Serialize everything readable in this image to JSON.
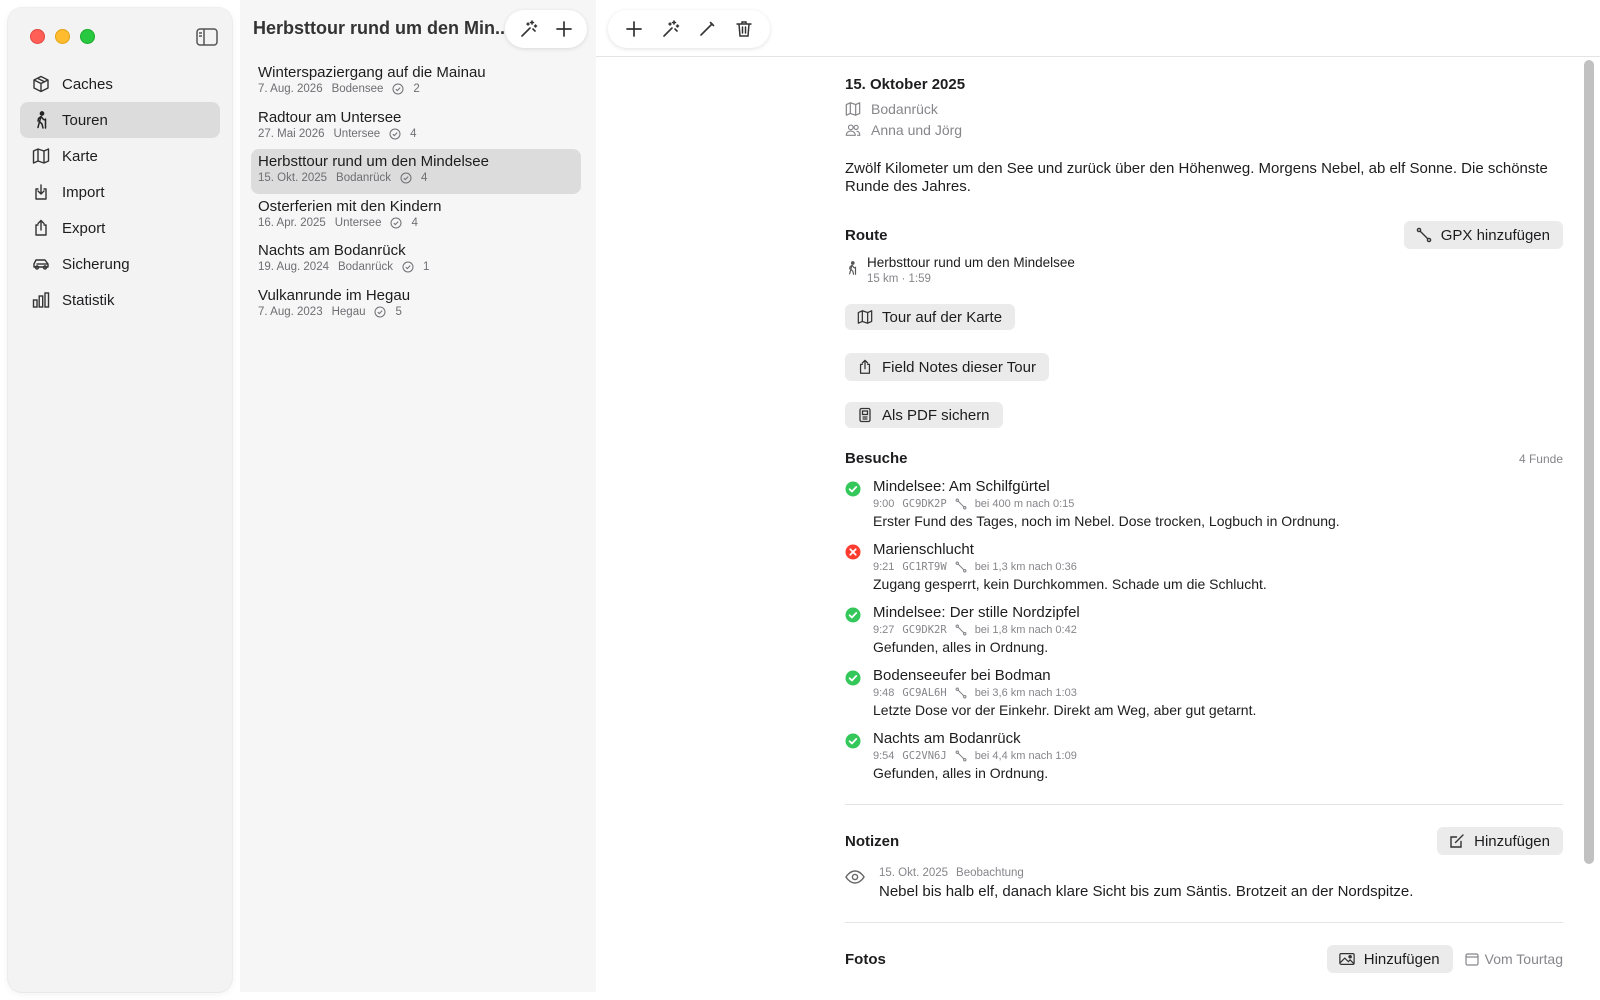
{
  "window": {
    "list_title": "Herbsttour rund um den Min..."
  },
  "sidebar": {
    "items": [
      {
        "label": "Caches",
        "icon": "cube-icon"
      },
      {
        "label": "Touren",
        "icon": "hiker-icon"
      },
      {
        "label": "Karte",
        "icon": "map-icon"
      },
      {
        "label": "Import",
        "icon": "import-icon"
      },
      {
        "label": "Export",
        "icon": "share-icon"
      },
      {
        "label": "Sicherung",
        "icon": "backup-car-icon"
      },
      {
        "label": "Statistik",
        "icon": "bar-chart-icon"
      }
    ],
    "active_index": 1
  },
  "tours": [
    {
      "name": "Winterspaziergang auf die Mainau",
      "date": "7. Aug. 2026",
      "region": "Bodensee",
      "count": "2"
    },
    {
      "name": "Radtour am Untersee",
      "date": "27. Mai 2026",
      "region": "Untersee",
      "count": "4"
    },
    {
      "name": "Herbsttour rund um den Mindelsee",
      "date": "15. Okt. 2025",
      "region": "Bodanrück",
      "count": "4"
    },
    {
      "name": "Osterferien mit den Kindern",
      "date": "16. Apr. 2025",
      "region": "Untersee",
      "count": "4"
    },
    {
      "name": "Nachts am Bodanrück",
      "date": "19. Aug. 2024",
      "region": "Bodanrück",
      "count": "1"
    },
    {
      "name": "Vulkanrunde im Hegau",
      "date": "7. Aug. 2023",
      "region": "Hegau",
      "count": "5"
    }
  ],
  "selected_tour_index": 2,
  "detail": {
    "date": "15. Oktober 2025",
    "region": "Bodanrück",
    "participants": "Anna und Jörg",
    "description": "Zwölf Kilometer um den See und zurück über den Höhenweg. Morgens Nebel, ab elf Sonne. Die schönste Runde des Jahres.",
    "route": {
      "title": "Route",
      "gpx_button": "GPX hinzufügen",
      "name": "Herbsttour rund um den Mindelsee",
      "stats": "15 km · 1:59"
    },
    "actions": {
      "map": "Tour auf der Karte",
      "field_notes": "Field Notes dieser Tour",
      "pdf": "Als PDF sichern"
    },
    "visits": {
      "title": "Besuche",
      "count": "4 Funde",
      "items": [
        {
          "name": "Mindelsee: Am Schilfgürtel",
          "time": "9:00",
          "code": "GC9DK2P",
          "distance": "bei 400 m nach 0:15",
          "note": "Erster Fund des Tages, noch im Nebel. Dose trocken, Logbuch in Ordnung.",
          "status": "found"
        },
        {
          "name": "Marienschlucht",
          "time": "9:21",
          "code": "GC1RT9W",
          "distance": "bei 1,3 km nach 0:36",
          "note": "Zugang gesperrt, kein Durchkommen. Schade um die Schlucht.",
          "status": "dnf"
        },
        {
          "name": "Mindelsee: Der stille Nordzipfel",
          "time": "9:27",
          "code": "GC9DK2R",
          "distance": "bei 1,8 km nach 0:42",
          "note": "Gefunden, alles in Ordnung.",
          "status": "found"
        },
        {
          "name": "Bodenseeufer bei Bodman",
          "time": "9:48",
          "code": "GC9AL6H",
          "distance": "bei 3,6 km nach 1:03",
          "note": "Letzte Dose vor der Einkehr. Direkt am Weg, aber gut getarnt.",
          "status": "found"
        },
        {
          "name": "Nachts am Bodanrück",
          "time": "9:54",
          "code": "GC2VN6J",
          "distance": "bei 4,4 km nach 1:09",
          "note": "Gefunden, alles in Ordnung.",
          "status": "found"
        }
      ]
    },
    "notes": {
      "title": "Notizen",
      "add_button": "Hinzufügen",
      "items": [
        {
          "date": "15. Okt. 2025",
          "type": "Beobachtung",
          "text": "Nebel bis halb elf, danach klare Sicht bis zum Säntis. Brotzeit an der Nordspitze."
        }
      ]
    },
    "photos": {
      "title": "Fotos",
      "add_button": "Hinzufügen",
      "from_day_button": "Vom Tourtag"
    }
  },
  "colors": {
    "found": "#34c759",
    "dnf": "#ff3b30",
    "selection": "#dcdcdc"
  }
}
